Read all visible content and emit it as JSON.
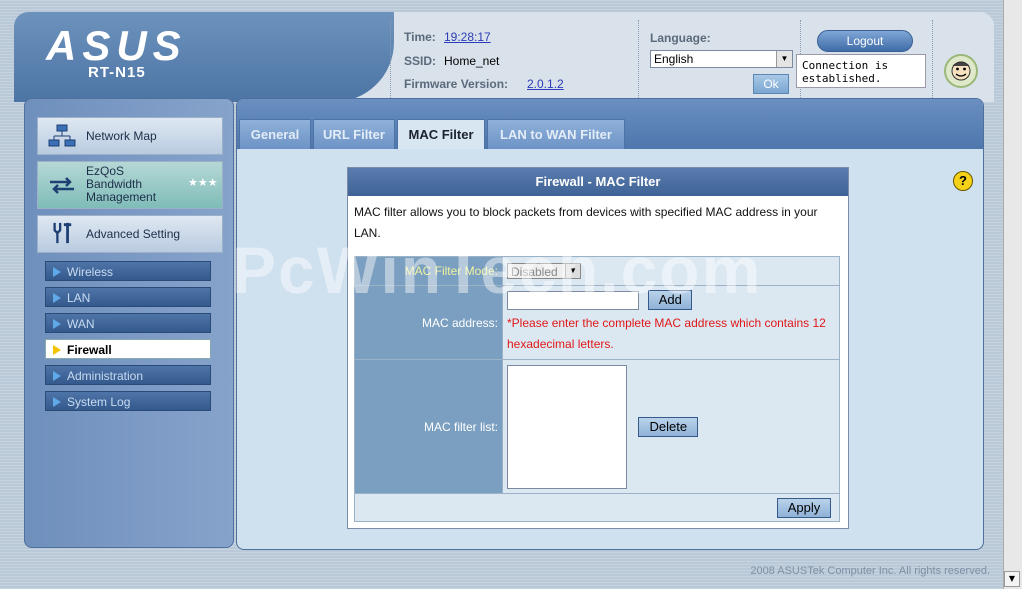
{
  "brand": {
    "logo": "ASUS",
    "model": "RT-N15"
  },
  "header": {
    "time_label": "Time:",
    "time_value": "19:28:17",
    "ssid_label": "SSID:",
    "ssid_value": "Home_net",
    "fw_label": "Firmware Version:",
    "fw_value": "2.0.1.2",
    "language_label": "Language:",
    "language_value": "English",
    "ok_label": "Ok",
    "logout_label": "Logout",
    "connection_line1": "Connection is",
    "connection_line2": "established."
  },
  "sidebar": {
    "network_map": "Network Map",
    "ezqos": [
      "EzQoS",
      "Bandwidth",
      "Management"
    ],
    "advanced": "Advanced Setting",
    "items": [
      {
        "label": "Wireless",
        "active": false
      },
      {
        "label": "LAN",
        "active": false
      },
      {
        "label": "WAN",
        "active": false
      },
      {
        "label": "Firewall",
        "active": true
      },
      {
        "label": "Administration",
        "active": false
      },
      {
        "label": "System Log",
        "active": false
      }
    ]
  },
  "tabs": [
    {
      "label": "General"
    },
    {
      "label": "URL Filter"
    },
    {
      "label": "MAC Filter"
    },
    {
      "label": "LAN to WAN Filter"
    }
  ],
  "panel": {
    "title": "Firewall - MAC Filter",
    "description_line1": "MAC filter allows you to block packets from devices with specified MAC address in your",
    "description_line2": "LAN.",
    "mode_label": "MAC Filter Mode:",
    "mode_value": "Disabled",
    "mac_label": "MAC address:",
    "mac_value": "",
    "add_label": "Add",
    "warn_line1": "*Please enter the complete MAC address which contains 12",
    "warn_line2": "hexadecimal letters.",
    "list_label": "MAC filter list:",
    "delete_label": "Delete",
    "apply_label": "Apply"
  },
  "help_icon": "?",
  "footer": "2008 ASUSTek Computer Inc. All rights reserved.",
  "watermark": "PcWinTech.com",
  "colors": {
    "accent": "#4f77ad",
    "warning": "#e01818",
    "help": "#f5d218"
  }
}
